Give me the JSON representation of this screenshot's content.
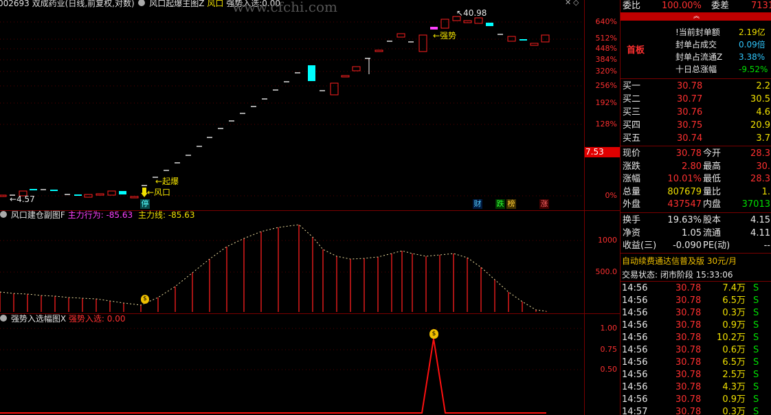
{
  "main": {
    "title_code": "002693",
    "title_name": "双成药业(日线,前复权,对数)",
    "indicator": "风口起爆主图Z",
    "ind_v1": "风口",
    "ind_v2": "强势入选:0.00",
    "axis": [
      "640%",
      "512%",
      "448%",
      "384%",
      "320%",
      "256%",
      "192%",
      "128%",
      "0%"
    ],
    "price_tag": "7.53",
    "labels": {
      "high": "40.98",
      "low": "4.57",
      "qiangshi": "←强势",
      "qibao": "←起爆",
      "fengkou": "←风口"
    },
    "markers": {
      "ting": "停",
      "cai": "财",
      "die": "跌",
      "bang": "榜",
      "zhang": "涨"
    }
  },
  "sub1": {
    "name": "风口建仓副图F",
    "k1": "主力行为:",
    "v1": "-85.63",
    "k2": "主力线:",
    "v2": "-85.63",
    "axis": [
      "1000",
      "500.0"
    ]
  },
  "sub2": {
    "name": "强势入选幅图X",
    "k1": "强势入选:",
    "v1": "0.00",
    "axis": [
      "1.00",
      "0.75",
      "0.50"
    ]
  },
  "watermark": "www.cfchi.com",
  "quote": {
    "weibi_l": "委比",
    "weibi_v": "100.00%",
    "weicha_l": "委差",
    "weicha_v": "7131",
    "board": "首板",
    "seal": [
      {
        "k": "!当前封单额",
        "v": "2.19亿",
        "c": "yellow"
      },
      {
        "k": "封单占成交",
        "v": "0.09倍",
        "c": "cyan"
      },
      {
        "k": "封单占流通Z",
        "v": "3.38%",
        "c": "cyan"
      },
      {
        "k": "十日总涨幅",
        "v": "-9.52%",
        "c": "green"
      }
    ],
    "bids": [
      {
        "l": "买一",
        "p": "30.78",
        "q": "2.2"
      },
      {
        "l": "买二",
        "p": "30.77",
        "q": "30.5"
      },
      {
        "l": "买三",
        "p": "30.76",
        "q": "4.6"
      },
      {
        "l": "买四",
        "p": "30.75",
        "q": "20.9"
      },
      {
        "l": "买五",
        "p": "30.74",
        "q": "3.7"
      }
    ],
    "stats": [
      {
        "l1": "现价",
        "v1": "30.78",
        "c1": "red",
        "l2": "今开",
        "v2": "28.3",
        "c2": "red"
      },
      {
        "l1": "涨跌",
        "v1": "2.80",
        "c1": "red",
        "l2": "最高",
        "v2": "30.",
        "c2": "red"
      },
      {
        "l1": "涨幅",
        "v1": "10.01%",
        "c1": "red",
        "l2": "最低",
        "v2": "28.3",
        "c2": "red"
      },
      {
        "l1": "总量",
        "v1": "807679",
        "c1": "yellow",
        "l2": "量比",
        "v2": "1.",
        "c2": "yellow"
      },
      {
        "l1": "外盘",
        "v1": "437547",
        "c1": "red",
        "l2": "内盘",
        "v2": "37013",
        "c2": "green"
      }
    ],
    "fin": [
      {
        "l1": "换手",
        "v1": "19.63%",
        "l2": "股本",
        "v2": "4.15"
      },
      {
        "l1": "净资",
        "v1": "1.05",
        "l2": "流通",
        "v2": "4.11"
      },
      {
        "l1": "收益(三)",
        "v1": "-0.090",
        "l2": "PE(动)",
        "v2": "--"
      }
    ],
    "promo": "自动续费通达信普及版  30元/月",
    "trade_status": "交易状态: 闭市阶段 15:33:06",
    "ticks": [
      {
        "t": "14:56",
        "p": "30.78",
        "v": "7.4万",
        "s": "S"
      },
      {
        "t": "14:56",
        "p": "30.78",
        "v": "6.5万",
        "s": "S"
      },
      {
        "t": "14:56",
        "p": "30.78",
        "v": "0.3万",
        "s": "S"
      },
      {
        "t": "14:56",
        "p": "30.78",
        "v": "0.9万",
        "s": "S"
      },
      {
        "t": "14:56",
        "p": "30.78",
        "v": "10.2万",
        "s": "S"
      },
      {
        "t": "14:56",
        "p": "30.78",
        "v": "0.6万",
        "s": "S"
      },
      {
        "t": "14:56",
        "p": "30.78",
        "v": "6.5万",
        "s": "S"
      },
      {
        "t": "14:56",
        "p": "30.78",
        "v": "2.5万",
        "s": "S"
      },
      {
        "t": "14:56",
        "p": "30.78",
        "v": "4.3万",
        "s": "S"
      },
      {
        "t": "14:56",
        "p": "30.78",
        "v": "0.9万",
        "s": "S"
      },
      {
        "t": "14:57",
        "p": "30.78",
        "v": "0.3万",
        "s": "S"
      }
    ]
  },
  "colors": {
    "up": "#ff2020",
    "down": "#00ffff",
    "flat": "#ffffff",
    "grid": "#7a0000"
  }
}
